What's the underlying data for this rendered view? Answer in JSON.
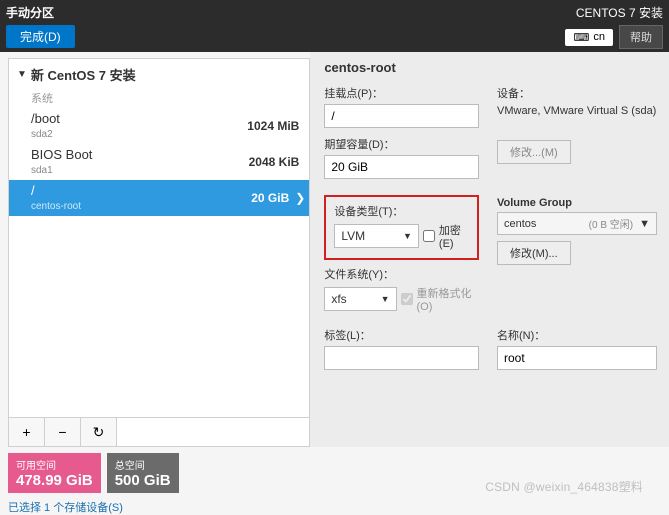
{
  "top": {
    "title": "手动分区",
    "done": "完成(D)",
    "installer_title": "CENTOS 7 安装",
    "lang_code": "cn",
    "help": "帮助"
  },
  "tree": {
    "header": "新 CentOS 7 安装",
    "system_label": "系统",
    "items": [
      {
        "name": "/boot",
        "sub": "sda2",
        "size": "1024 MiB",
        "selected": false
      },
      {
        "name": "BIOS Boot",
        "sub": "sda1",
        "size": "2048 KiB",
        "selected": false
      },
      {
        "name": "/",
        "sub": "centos-root",
        "size": "20 GiB",
        "selected": true
      }
    ]
  },
  "details": {
    "title": "centos-root",
    "mountpoint_label": "挂载点(P)：",
    "mountpoint_value": "/",
    "capacity_label": "期望容量(D)：",
    "capacity_value": "20 GiB",
    "device_label": "设备：",
    "device_value": "VMware, VMware Virtual S (sda)",
    "modify_btn": "修改...(M)",
    "dtype_label": "设备类型(T)：",
    "dtype_value": "LVM",
    "encrypt_label": "加密(E)",
    "fs_label": "文件系统(Y)：",
    "fs_value": "xfs",
    "reformat_label": "重新格式化(O)",
    "vg_label": "Volume Group",
    "vg_value": "centos",
    "vg_free": "(0 B 空闲)",
    "vg_modify": "修改(M)...",
    "label_label": "标签(L)：",
    "label_value": "",
    "name_label": "名称(N)：",
    "name_value": "root"
  },
  "footer": {
    "avail_label": "可用空间",
    "avail_value": "478.99 GiB",
    "total_label": "总空间",
    "total_value": "500 GiB",
    "storage_link": "已选择 1 个存储设备(S)"
  },
  "watermark": "CSDN @weixin_464838塑料"
}
